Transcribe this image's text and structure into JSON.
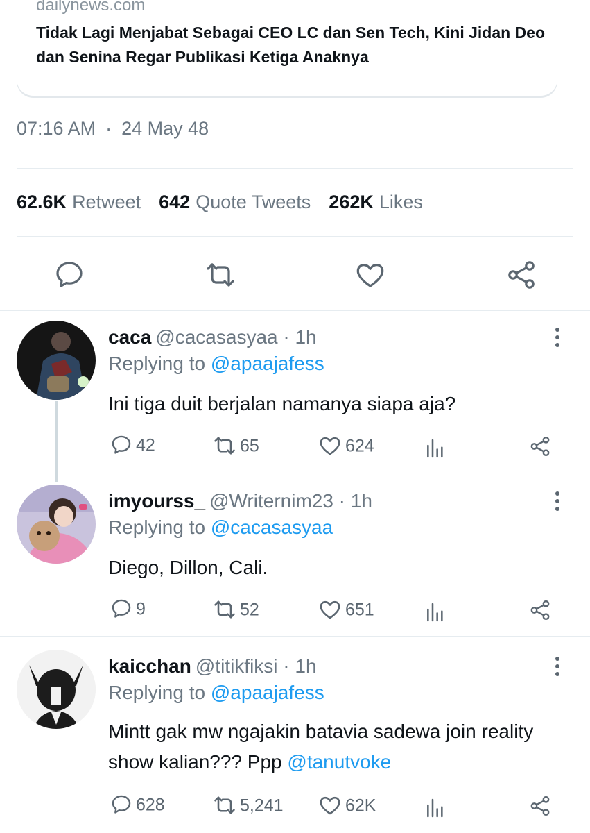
{
  "card": {
    "domain": "dailynews.com",
    "headline": "Tidak Lagi Menjabat Sebagai CEO LC dan Sen Tech, Kini Jidan Deo dan Senina Regar Publikasi Ketiga Anaknya"
  },
  "tweet": {
    "time": "07:16 AM",
    "separator": "·",
    "date": "24 May 48",
    "stats": {
      "retweets_count": "62.6K",
      "retweets_label": "Retweet",
      "quotes_count": "642",
      "quotes_label": "Quote Tweets",
      "likes_count": "262K",
      "likes_label": "Likes"
    }
  },
  "replies": [
    {
      "name": "caca",
      "handle": "@cacasasyaa · 1h",
      "replying_prefix": "Replying to",
      "replying_to": "@apaajafess",
      "text": "Ini tiga duit berjalan namanya siapa aja?",
      "replies": "42",
      "retweets": "65",
      "likes": "624"
    },
    {
      "name": "imyourss_",
      "handle": "@Writernim23 · 1h",
      "replying_prefix": "Replying to",
      "replying_to": "@cacasasyaa",
      "text": "Diego, Dillon, Cali.",
      "replies": "9",
      "retweets": "52",
      "likes": "651"
    },
    {
      "name": "kaicchan",
      "handle": "@titikfiksi · 1h",
      "replying_prefix": "Replying to",
      "replying_to": "@apaajafess",
      "text": "Mintt gak mw ngajakin batavia sadewa join reality show kalian??? Ppp",
      "text_mention": "@tanutvoke",
      "replies": "628",
      "retweets": "5,241",
      "likes": "62K"
    }
  ],
  "icons": {
    "reply": "reply-bubble-icon",
    "retweet": "retweet-icon",
    "like": "heart-icon",
    "share": "share-icon",
    "analytics": "analytics-icon",
    "more": "more-vertical-icon"
  },
  "colors": {
    "accent": "#1d9bf0",
    "muted": "#6b7782",
    "text": "#0f1419",
    "divider": "#e6ecf0"
  }
}
